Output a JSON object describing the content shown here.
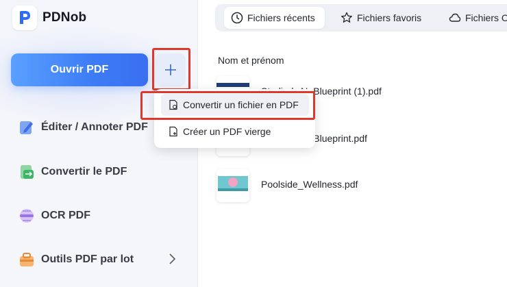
{
  "app": {
    "name": "PDNob"
  },
  "sidebar": {
    "open_button": "Ouvrir PDF",
    "plus_label": "+",
    "items": [
      {
        "label": "Éditer / Annoter PDF",
        "icon": "edit-icon"
      },
      {
        "label": "Convertir le PDF",
        "icon": "convert-icon"
      },
      {
        "label": "OCR PDF",
        "icon": "ocr-icon"
      },
      {
        "label": "Outils PDF par lot",
        "icon": "batch-tools-icon"
      }
    ]
  },
  "add_menu": {
    "items": [
      {
        "label": "Convertir un fichier en PDF",
        "icon": "file-convert-icon"
      },
      {
        "label": "Créer un PDF vierge",
        "icon": "file-add-icon"
      }
    ]
  },
  "tabs": [
    {
      "label": "Fichiers récents",
      "icon": "clock-icon",
      "active": true
    },
    {
      "label": "Fichiers favoris",
      "icon": "star-icon",
      "active": false
    },
    {
      "label": "Fichiers C",
      "icon": "cloud-icon",
      "active": false
    }
  ],
  "file_list": {
    "column_header": "Nom et prénom",
    "files": [
      {
        "name": "Studied_AI_Blueprint (1).pdf"
      },
      {
        "name": "Studied_AI_Blueprint.pdf"
      },
      {
        "name": "Poolside_Wellness.pdf"
      }
    ]
  },
  "colors": {
    "accent": "#3c7cf6",
    "highlight_box": "#e0362c"
  }
}
